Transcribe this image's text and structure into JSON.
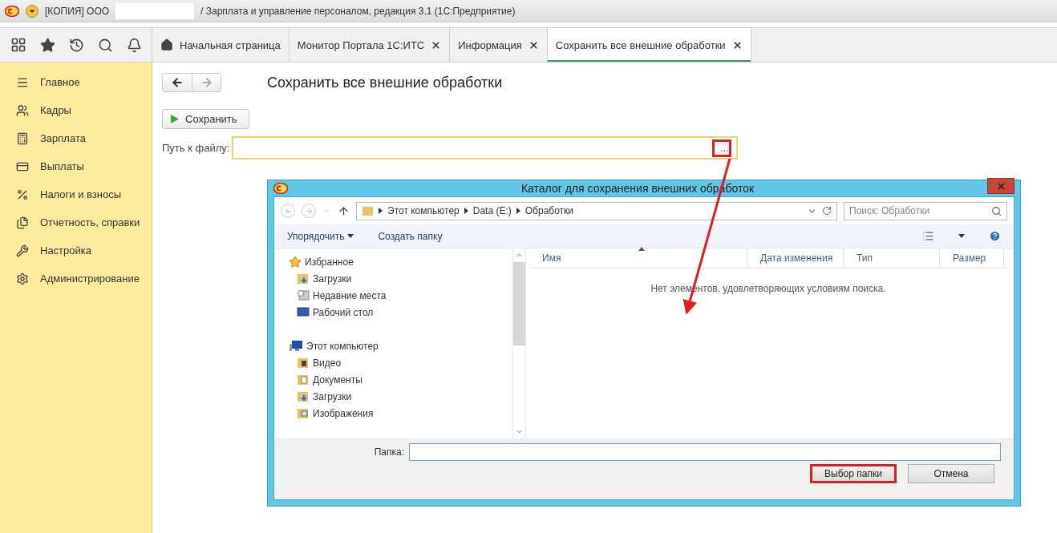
{
  "title_bar": {
    "prefix": "[КОПИЯ] ООО",
    "suffix": "/ Зарплата и управление персоналом, редакция 3.1  (1С:Предприятие)"
  },
  "tabs": [
    {
      "label": "Начальная страница",
      "kind": "home",
      "selected": false
    },
    {
      "label": "Монитор Портала 1С:ИТС",
      "kind": "closable",
      "selected": false
    },
    {
      "label": "Информация",
      "kind": "closable",
      "selected": false
    },
    {
      "label": "Сохранить все внешние обработки",
      "kind": "closable",
      "selected": true
    }
  ],
  "sidebar": {
    "items": [
      {
        "label": "Главное",
        "kind": "main"
      },
      {
        "label": "Кадры",
        "kind": "staff"
      },
      {
        "label": "Зарплата",
        "kind": "salary"
      },
      {
        "label": "Выплаты",
        "kind": "payments"
      },
      {
        "label": "Налоги и взносы",
        "kind": "taxes"
      },
      {
        "label": "Отчетность, справки",
        "kind": "reports"
      },
      {
        "label": "Настройка",
        "kind": "settings"
      },
      {
        "label": "Администрирование",
        "kind": "admin"
      }
    ]
  },
  "page": {
    "title": "Сохранить все внешние обработки",
    "save_button": "Сохранить",
    "path_label": "Путь к файлу:",
    "browse_button": {
      "label": "...",
      "highlighted": true
    }
  },
  "dialog": {
    "title": "Каталог для сохранения внешних обработок",
    "breadcrumbs": [
      "Этот компьютер",
      "Data (E:)",
      "Обработки"
    ],
    "search_placeholder": "Поиск: Обработки",
    "commands": [
      {
        "label": "Упорядочить",
        "dropdown": true
      },
      {
        "label": "Создать папку",
        "dropdown": false
      }
    ],
    "tree": [
      {
        "label": "Избранное",
        "kind": "favorites",
        "children": [
          {
            "label": "Загрузки",
            "kind": "downloads"
          },
          {
            "label": "Недавние места",
            "kind": "recent"
          },
          {
            "label": "Рабочий стол",
            "kind": "desktop"
          }
        ]
      },
      {
        "label": "Этот компьютер",
        "kind": "computer",
        "children": [
          {
            "label": "Видео",
            "kind": "video"
          },
          {
            "label": "Документы",
            "kind": "documents"
          },
          {
            "label": "Загрузки",
            "kind": "downloads"
          },
          {
            "label": "Изображения",
            "kind": "pictures"
          }
        ]
      }
    ],
    "columns": [
      "Имя",
      "Дата изменения",
      "Тип",
      "Размер"
    ],
    "empty_message": "Нет элементов, удовлетворяющих условиям поиска.",
    "folder_label": "Папка:",
    "buttons": [
      {
        "label": "Выбор папки",
        "highlighted": true
      },
      {
        "label": "Отмена",
        "highlighted": false
      }
    ]
  }
}
